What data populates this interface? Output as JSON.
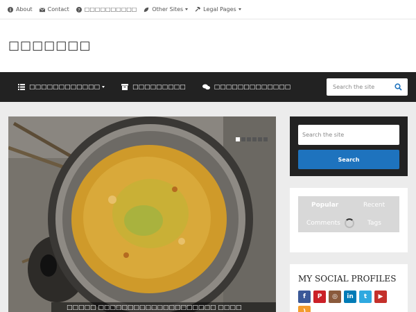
{
  "topbar": {
    "items": [
      {
        "label": "About",
        "icon": "info-icon"
      },
      {
        "label": "Contact",
        "icon": "envelope-icon"
      },
      {
        "label": "□□□□□□□□□□",
        "icon": "question-icon"
      },
      {
        "label": "Other Sites",
        "icon": "leaf-icon",
        "dropdown": true
      },
      {
        "label": "Legal Pages",
        "icon": "gavel-icon",
        "dropdown": true
      }
    ]
  },
  "header": {
    "site_title": "□□□□□□□"
  },
  "nav": {
    "items": [
      {
        "label": "□□□□□□□□□□□□",
        "icon": "list-icon",
        "dropdown": true
      },
      {
        "label": "□□□□□□□□□",
        "icon": "archive-icon"
      },
      {
        "label": "□□□□□□□□□□□□□",
        "icon": "comments-icon"
      }
    ],
    "search_placeholder": "Search the site"
  },
  "slider": {
    "caption": "□□□□□ □□□□□□□□□□□□□□□□□□□□ □□□□",
    "slide_count": 6,
    "active_slide": 1
  },
  "sidebar": {
    "search": {
      "placeholder": "Search the site",
      "button_label": "Search"
    },
    "tabs": {
      "items": [
        "Popular",
        "Recent",
        "Comments",
        "Tags"
      ],
      "active": "Popular"
    },
    "social": {
      "title": "MY SOCIAL PROFILES",
      "icons": [
        {
          "name": "facebook-icon",
          "glyph": "f",
          "color": "#3b5998"
        },
        {
          "name": "pinterest-icon",
          "glyph": "P",
          "color": "#cb2027"
        },
        {
          "name": "instagram-icon",
          "glyph": "◎",
          "color": "#8a5a3c"
        },
        {
          "name": "linkedin-icon",
          "glyph": "in",
          "color": "#007bb6"
        },
        {
          "name": "twitter-icon",
          "glyph": "t",
          "color": "#2fa9e0"
        },
        {
          "name": "youtube-icon",
          "glyph": "▶",
          "color": "#c4302b"
        }
      ],
      "rss": {
        "name": "rss-icon",
        "glyph": ")",
        "color": "#f39c2d"
      }
    }
  },
  "colors": {
    "nav_bg": "#222222",
    "accent": "#1e73be",
    "page_bg": "#ececec"
  }
}
